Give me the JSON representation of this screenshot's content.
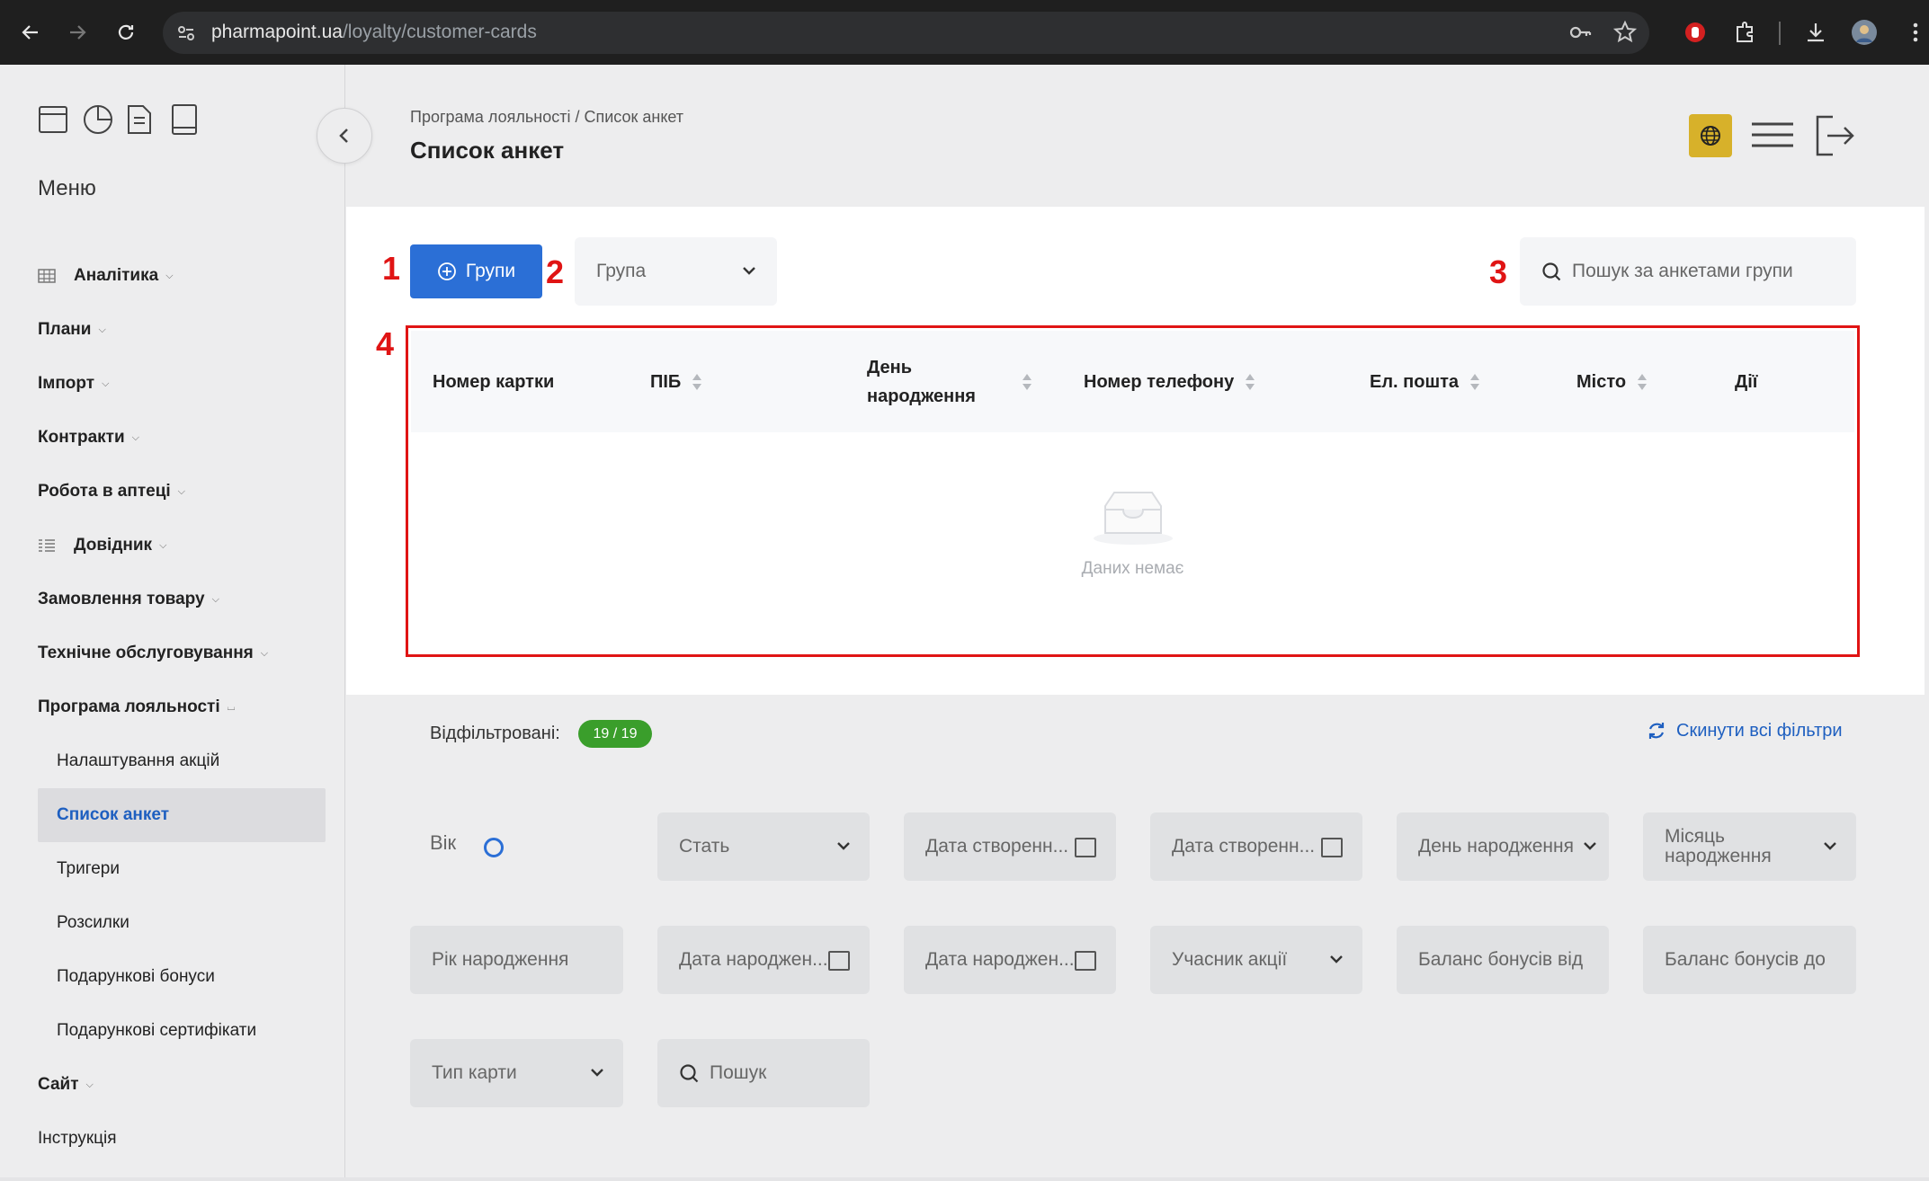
{
  "browser": {
    "url_host": "pharmapoint.ua",
    "url_path": "/loyalty/customer-cards"
  },
  "sidebar": {
    "menu_title": "Меню",
    "items": [
      {
        "label": "Аналітика",
        "icon": "grid-icon",
        "expand": "down"
      },
      {
        "label": "Плани",
        "expand": "down"
      },
      {
        "label": "Імпорт",
        "expand": "down"
      },
      {
        "label": "Контракти",
        "expand": "down"
      },
      {
        "label": "Робота в аптеці",
        "expand": "down"
      },
      {
        "label": "Довідник",
        "icon": "list-icon",
        "expand": "down"
      },
      {
        "label": "Замовлення товару",
        "expand": "down"
      },
      {
        "label": "Технічне обслуговування",
        "expand": "down"
      },
      {
        "label": "Програма лояльності",
        "expand": "up"
      }
    ],
    "subitems": [
      {
        "label": "Налаштування акцій"
      },
      {
        "label": "Список анкет",
        "active": true
      },
      {
        "label": "Тригери"
      },
      {
        "label": "Розсилки"
      },
      {
        "label": "Подарункові бонуси"
      },
      {
        "label": "Подарункові сертифікати"
      }
    ],
    "bottom_items": [
      {
        "label": "Сайт",
        "expand": "down"
      },
      {
        "label": "Інструкція"
      }
    ]
  },
  "header": {
    "breadcrumb": "Програма лояльності / Список анкет",
    "title": "Список анкет",
    "accent_color": "#d7b12a"
  },
  "toolbar": {
    "groups_button": "Групи",
    "group_select_placeholder": "Група",
    "search_placeholder": "Пошук за анкетами групи"
  },
  "markers": [
    "1",
    "2",
    "3",
    "4"
  ],
  "table": {
    "columns": [
      "Номер картки",
      "ПІБ",
      "День народження",
      "Номер телефону",
      "Ел. пошта",
      "Місто",
      "Дії"
    ],
    "empty_text": "Даних немає"
  },
  "filters": {
    "filtered_label": "Відфільтровані:",
    "filtered_count": "19 / 19",
    "reset_label": "Скинути всі фільтри",
    "age_label": "Вік",
    "gender": "Стать",
    "created_from": "Дата створенн...",
    "created_to": "Дата створенн...",
    "birth_day": "День народження",
    "birth_month": "Місяць народження",
    "birth_year": "Рік народження",
    "birth_date_from": "Дата народжен...",
    "birth_date_to": "Дата народжен...",
    "promo_participant": "Учасник акції",
    "bonus_from": "Баланс бонусів від",
    "bonus_to": "Баланс бонусів до",
    "card_type": "Тип карти",
    "search": "Пошук",
    "badge_color": "#3a9e2b",
    "primary_color": "#2b6fd6"
  }
}
